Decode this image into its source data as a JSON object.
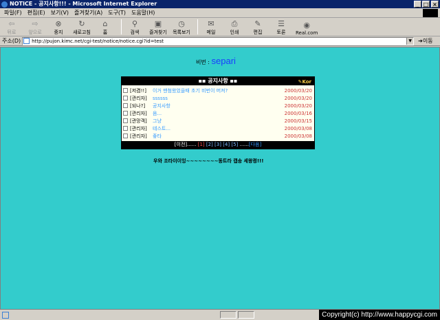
{
  "window": {
    "title": "NOTICE - 공지사항!!! - Microsoft Internet Explorer"
  },
  "menu": [
    "파일(F)",
    "편집(E)",
    "보기(V)",
    "즐겨찾기(A)",
    "도구(T)",
    "도움말(H)"
  ],
  "toolbar": {
    "back": "뒤로",
    "forward": "앞으로",
    "stop": "중지",
    "refresh": "새로고침",
    "home": "홈",
    "search": "검색",
    "favorites": "즐겨찾기",
    "history": "목록보기",
    "mail": "메일",
    "print": "인쇄",
    "edit": "편집",
    "discuss": "토론",
    "realcom": "Real.com"
  },
  "address": {
    "label": "주소(D)",
    "url": "http://pujon.kimc.net/cgi-test/notice/notice.cgi?id=test",
    "go": "이동"
  },
  "page": {
    "id_label": "비번 :",
    "id_value": "separi",
    "board_title": "공지사항",
    "rss_label": "Kor",
    "rows": [
      {
        "author": "[저겸!!]",
        "subject": "이거 맨첨왔었을때 초기 비번이 머져?",
        "date": "2000/03/20"
      },
      {
        "author": "[관리자]",
        "subject": "ssssss",
        "date": "2000/03/20"
      },
      {
        "author": "[되나?]",
        "subject": "공지사항",
        "date": "2000/03/20"
      },
      {
        "author": "[관리자]",
        "subject": "음...",
        "date": "2000/03/16"
      },
      {
        "author": "[관망객]",
        "subject": "그냥",
        "date": "2000/03/15"
      },
      {
        "author": "[관리자]",
        "subject": "테스트...",
        "date": "2000/03/08"
      },
      {
        "author": "[관리자]",
        "subject": "좋타",
        "date": "2000/03/08"
      }
    ],
    "pager": {
      "prev": "[이전]......",
      "pages": [
        "[1]",
        "[2]",
        "[3]",
        "[4]",
        "[5]"
      ],
      "sep": "......",
      "next": "[다음]"
    },
    "message": "우와 조타이이잉~~~~~~~~동트라 캡송 세왕켱!!!"
  },
  "status": {
    "copyright": "Copyright(c) http://www.happycgi.com"
  },
  "colors": {
    "page_bg": "#33cccc",
    "link_blue": "#3399ff",
    "date_red": "#cc3333",
    "title_bar": "#0a246a"
  }
}
